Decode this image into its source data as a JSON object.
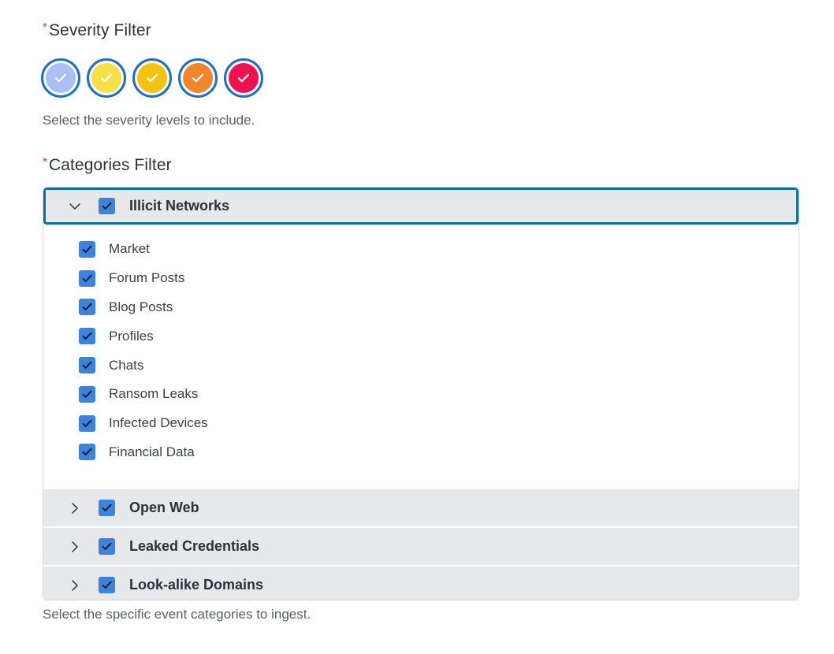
{
  "severity": {
    "label": "Severity Filter",
    "required_mark": "*",
    "help": "Select the severity levels to include.",
    "levels": [
      {
        "color": "#aabff5",
        "selected": true
      },
      {
        "color": "#f7e043",
        "selected": true
      },
      {
        "color": "#f3c30d",
        "selected": true
      },
      {
        "color": "#f3862d",
        "selected": true
      },
      {
        "color": "#f0124e",
        "selected": true
      }
    ]
  },
  "categories": {
    "label": "Categories Filter",
    "required_mark": "*",
    "help": "Select the specific event categories to ingest.",
    "groups": [
      {
        "title": "Illicit Networks",
        "expanded": true,
        "checked": true,
        "children": [
          {
            "label": "Market",
            "checked": true
          },
          {
            "label": "Forum Posts",
            "checked": true
          },
          {
            "label": "Blog Posts",
            "checked": true
          },
          {
            "label": "Profiles",
            "checked": true
          },
          {
            "label": "Chats",
            "checked": true
          },
          {
            "label": "Ransom Leaks",
            "checked": true
          },
          {
            "label": "Infected Devices",
            "checked": true
          },
          {
            "label": "Financial Data",
            "checked": true
          }
        ]
      },
      {
        "title": "Open Web",
        "expanded": false,
        "checked": true
      },
      {
        "title": "Leaked Credentials",
        "expanded": false,
        "checked": true
      },
      {
        "title": "Look-alike Domains",
        "expanded": false,
        "checked": true
      }
    ]
  },
  "colors": {
    "checkbox": "#3c83e0",
    "focus_ring": "#0d6f9a",
    "severity_ring": "#1b6fc9",
    "required": "#d13b2f"
  }
}
